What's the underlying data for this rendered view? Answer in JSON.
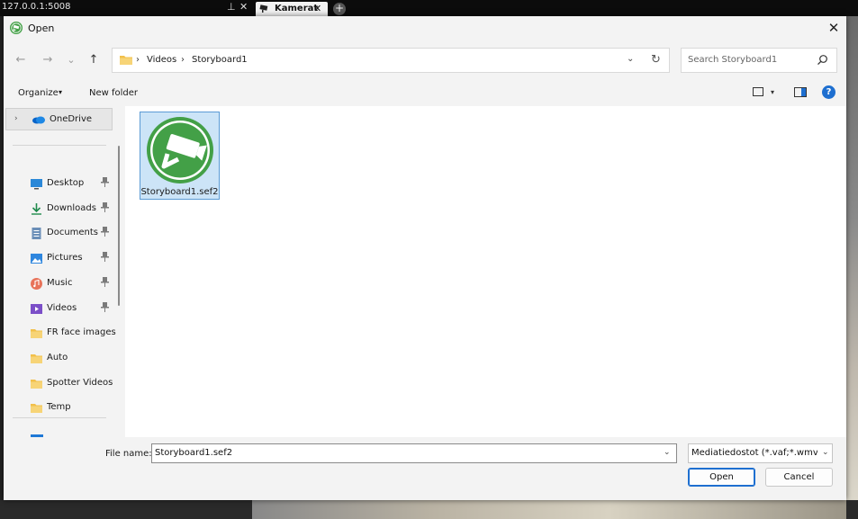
{
  "host": {
    "url": "127.0.0.1:5008",
    "pin_icon": "pin-icon",
    "close_glyph": "✕",
    "tab_label": "Kamerat",
    "tab_close": "✕",
    "add_glyph": "+"
  },
  "dialog": {
    "title": "Open",
    "close_glyph": "✕",
    "nav": {
      "back": "←",
      "forward": "→",
      "recent": "⌄",
      "up": "↑"
    },
    "address": {
      "crumbs": [
        "Videos",
        "Storyboard1"
      ],
      "separator": "›",
      "dropdown": "⌄",
      "refresh": "↻"
    },
    "search": {
      "placeholder": "Search Storyboard1"
    },
    "toolbar": {
      "organize": "Organize",
      "organize_caret": "▾",
      "new_folder": "New folder",
      "view_caret": "▾",
      "help": "?"
    },
    "navpane": {
      "onedrive": {
        "label": "OneDrive",
        "chevron": "›"
      },
      "quick_access": [
        {
          "label": "Desktop",
          "icon": "desktop-icon",
          "pinned": true
        },
        {
          "label": "Downloads",
          "icon": "downloads-icon",
          "pinned": true
        },
        {
          "label": "Documents",
          "icon": "documents-icon",
          "pinned": true
        },
        {
          "label": "Pictures",
          "icon": "pictures-icon",
          "pinned": true
        },
        {
          "label": "Music",
          "icon": "music-icon",
          "pinned": true
        },
        {
          "label": "Videos",
          "icon": "videos-icon",
          "pinned": true
        },
        {
          "label": "FR face images",
          "icon": "folder-icon",
          "pinned": false
        },
        {
          "label": "Auto",
          "icon": "folder-icon",
          "pinned": false
        },
        {
          "label": "Spotter Videos",
          "icon": "folder-icon",
          "pinned": false
        },
        {
          "label": "Temp",
          "icon": "folder-icon",
          "pinned": false
        }
      ],
      "pin_glyph": "📌"
    },
    "files": [
      {
        "name": "Storyboard1.sef2",
        "icon": "camera-app-icon",
        "selected": true
      }
    ],
    "bottom": {
      "file_name_label": "File name:",
      "file_name_value": "Storyboard1.sef2",
      "file_name_caret": "⌄",
      "file_type_value": "Mediatiedostot (*.vaf;*.wmv;*.v",
      "file_type_caret": "⌄",
      "open_button": "Open",
      "cancel_button": "Cancel"
    }
  },
  "colors": {
    "accent": "#1e6fd0",
    "selection": "#cce4f7",
    "app_green": "#43a047",
    "folder_yellow": "#f2c04b"
  }
}
